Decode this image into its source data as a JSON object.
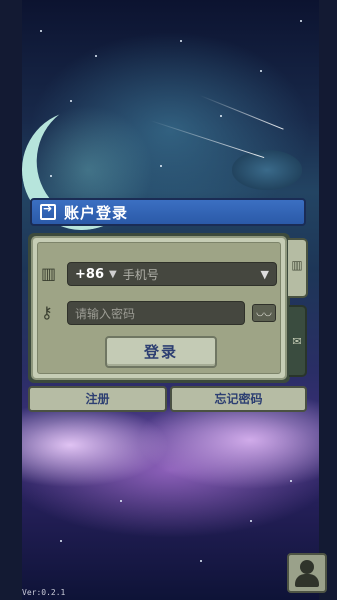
{
  "login_panel": {
    "title": "账户登录",
    "country_code": "+86",
    "phone_placeholder": "手机号",
    "password_placeholder": "请输入密码",
    "login_label": "登录"
  },
  "footer_buttons": {
    "register_label": "注册",
    "forgot_label": "忘记密码"
  },
  "version": "Ver:0.2.1",
  "icons": {
    "title": "login-arrow-icon",
    "phone": "phone-icon",
    "key": "key-icon",
    "eye": "eye-closed-icon",
    "mail": "mail-icon",
    "avatar": "user-avatar-icon"
  },
  "colors": {
    "title_bar": "#2b5aa8",
    "panel": "#9ea486",
    "button_text": "#2d3f72"
  }
}
